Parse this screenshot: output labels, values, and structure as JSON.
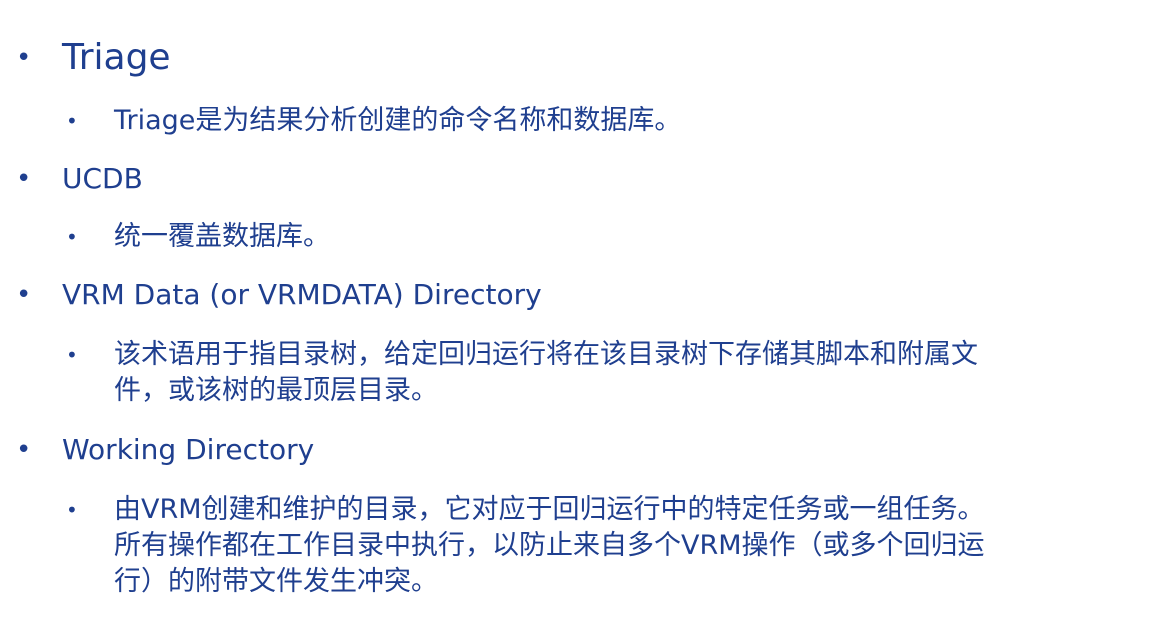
{
  "items": [
    {
      "label": "Triage",
      "sub": "Triage是为结果分析创建的命令名称和数据库。"
    },
    {
      "label": "UCDB",
      "sub": "统一覆盖数据库。"
    },
    {
      "label": "VRM Data (or VRMDATA) Directory",
      "sub_line1": "该术语用于指目录树，给定回归运行将在该目录树下存储其脚本和附属文",
      "sub_line2": "件，或该树的最顶层目录。"
    },
    {
      "label": "Working Directory",
      "sub_line1": "由VRM创建和维护的目录，它对应于回归运行中的特定任务或一组任务。",
      "sub_line2": "所有操作都在工作目录中执行，以防止来自多个VRM操作（或多个回归运",
      "sub_line3": "行）的附带文件发生冲突。"
    }
  ],
  "bullet_glyph": "•",
  "colors": {
    "text": "#1f3f8f",
    "background": "#ffffff"
  }
}
